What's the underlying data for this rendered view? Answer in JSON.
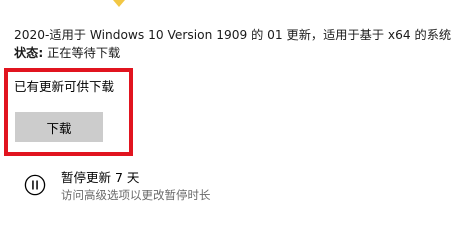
{
  "update": {
    "title": "2020-适用于 Windows 10 Version 1909 的 01 更新，适用于基于 x64 的系统",
    "status_label": "状态:",
    "status_value": " 正在等待下载"
  },
  "available": {
    "message": "已有更新可供下载",
    "download_label": "下载"
  },
  "pause": {
    "title": "暂停更新 7 天",
    "subtitle": "访问高级选项以更改暂停时长"
  },
  "colors": {
    "highlight": "#e1141f",
    "warning": "#f2c744",
    "button_bg": "#cccccc",
    "secondary_text": "#6a6a6a"
  },
  "icons": {
    "warning": "warning-icon",
    "pause": "pause-icon"
  }
}
